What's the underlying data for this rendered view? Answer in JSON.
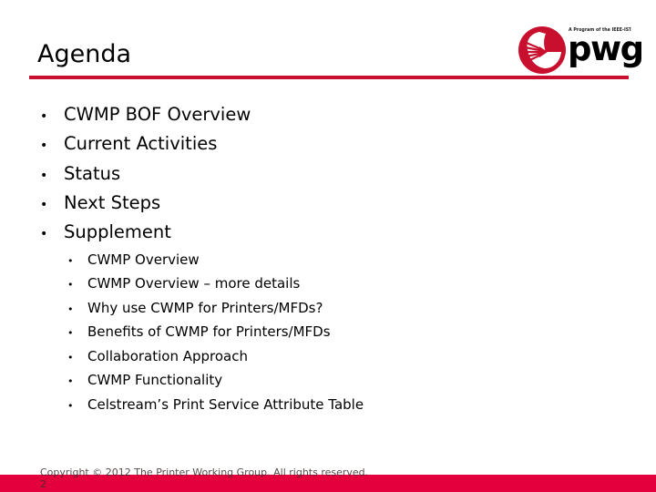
{
  "slide": {
    "title": "Agenda",
    "accent_color": "#c8102e",
    "footer_band_color": "#e3003c"
  },
  "logo": {
    "tagline": "A Program of the IEEE-ISTO",
    "wordmark": "pwg",
    "mark_color": "#c8102e"
  },
  "bullets": {
    "level1": [
      {
        "marker": "•",
        "text": "CWMP BOF Overview"
      },
      {
        "marker": "•",
        "text": "Current Activities"
      },
      {
        "marker": "•",
        "text": "Status"
      },
      {
        "marker": "•",
        "text": "Next Steps"
      },
      {
        "marker": "•",
        "text": "Supplement"
      }
    ],
    "level2": [
      {
        "marker": "•",
        "text": "CWMP Overview"
      },
      {
        "marker": "•",
        "text": "CWMP Overview – more details"
      },
      {
        "marker": "•",
        "text": "Why use CWMP for Printers/MFDs?"
      },
      {
        "marker": "•",
        "text": "Benefits of CWMP for Printers/MFDs"
      },
      {
        "marker": "•",
        "text": "Collaboration Approach"
      },
      {
        "marker": "•",
        "text": "CWMP Functionality"
      },
      {
        "marker": "•",
        "text": "Celstream’s Print Service Attribute Table"
      }
    ]
  },
  "footer": {
    "copyright": "Copyright © 2012 The Printer Working Group. All rights reserved.",
    "page_number": "2"
  }
}
